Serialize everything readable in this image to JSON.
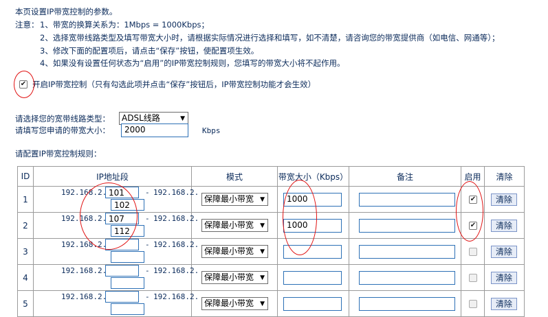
{
  "intro": "本页设置IP带宽控制的参数。",
  "notes": {
    "label": "注意：",
    "items": [
      "1、带宽的换算关系为：1Mbps = 1000Kbps；",
      "2、选择宽带线路类型及填写带宽大小时，请根据实际情况进行选择和填写，如不清楚，请咨询您的带宽提供商（如电信、网通等）；",
      "3、修改下面的配置项后，请点击“保存”按钮，使配置项生效。",
      "4、如果没有设置任何状态为“启用”的IP带宽控制规则，您填写的带宽大小将不起作用。"
    ]
  },
  "enable": {
    "checked": true,
    "label": "开启IP带宽控制（只有勾选此项并点击“保存”按钮后，IP带宽控制功能才会生效）"
  },
  "line_type": {
    "label": "请选择您的宽带线路类型：",
    "value": "ADSL线路"
  },
  "bandwidth": {
    "label": "请填写您申请的带宽大小：",
    "value": "2000",
    "unit": "Kbps"
  },
  "rules_title": "请配置IP带宽控制规则：",
  "columns": {
    "id": "ID",
    "ip": "IP地址段",
    "mode": "模式",
    "bw": "带宽大小（Kbps）",
    "note": "备注",
    "enable": "启用",
    "clear": "清除"
  },
  "ip_prefix": "192.168.2.",
  "dash": "-",
  "clear_label": "清除",
  "rows": [
    {
      "id": "1",
      "ip_start": "101",
      "ip_end": "102",
      "mode": "保障最小带宽",
      "bw": "1000",
      "note": "",
      "enabled": true
    },
    {
      "id": "2",
      "ip_start": "107",
      "ip_end": "112",
      "mode": "保障最小带宽",
      "bw": "1000",
      "note": "",
      "enabled": true
    },
    {
      "id": "3",
      "ip_start": "",
      "ip_end": "",
      "mode": "保障最小带宽",
      "bw": "",
      "note": "",
      "enabled": false
    },
    {
      "id": "4",
      "ip_start": "",
      "ip_end": "",
      "mode": "保障最小带宽",
      "bw": "",
      "note": "",
      "enabled": false
    },
    {
      "id": "5",
      "ip_start": "",
      "ip_end": "",
      "mode": "保障最小带宽",
      "bw": "",
      "note": "",
      "enabled": false
    }
  ],
  "colors": {
    "text": "#0a2a5a",
    "input_border": "#2b6fb5",
    "annotation": "#e01010"
  }
}
